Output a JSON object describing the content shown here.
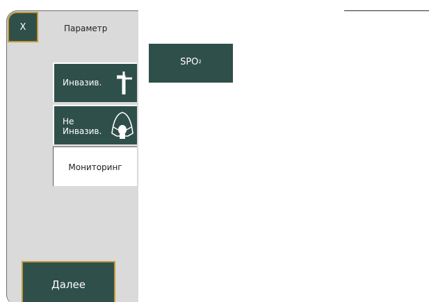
{
  "header": {
    "close_label": "X",
    "title": "Параметр"
  },
  "categories": [
    {
      "id": "invasive",
      "label": "Инвазив.",
      "icon": "invasive-tube-icon",
      "selected": false
    },
    {
      "id": "noninvasive",
      "label_line1": "Не",
      "label_line2": "Инвазив.",
      "icon": "mask-icon",
      "selected": false
    },
    {
      "id": "monitoring",
      "label": "Мониторинг",
      "icon": null,
      "selected": true
    }
  ],
  "parameters": [
    {
      "main": "SPO",
      "sub": "2"
    }
  ],
  "footer": {
    "next_label": "Далее"
  },
  "colors": {
    "button_bg": "#2f4f4a",
    "accent_border": "#c49a3a",
    "sidebar_bg": "#d9dad9",
    "selected_tab_bg": "#ffffff"
  }
}
